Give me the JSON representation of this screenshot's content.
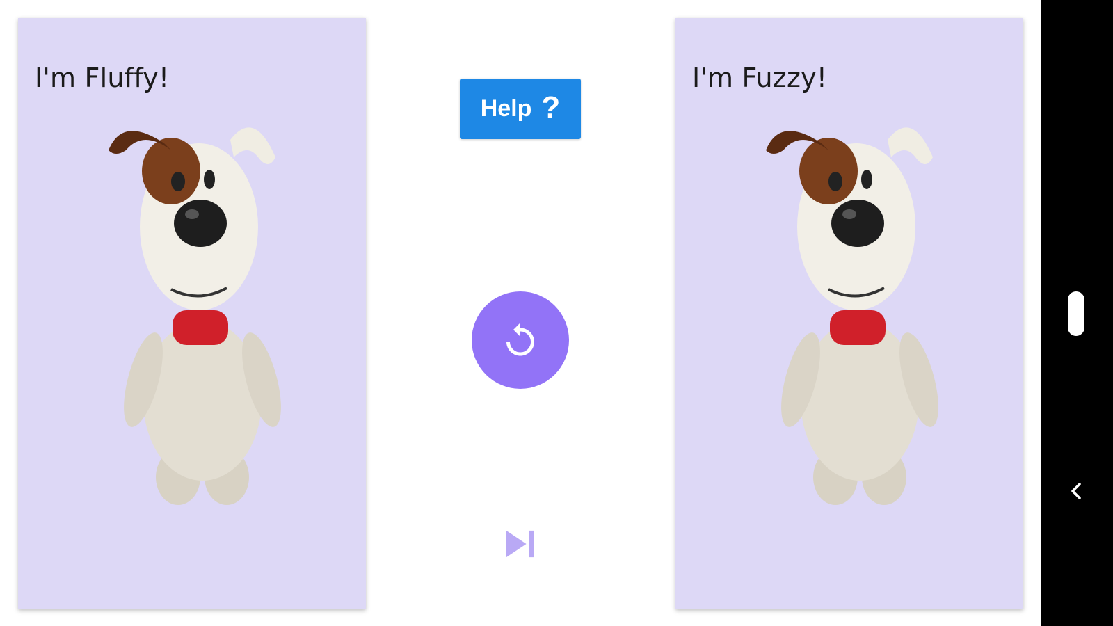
{
  "colors": {
    "card_background": "#ddd8f6",
    "help_button": "#1e88e5",
    "reset_button": "#9273f7",
    "skip_icon": "#b9a9f5",
    "nav_bar": "#000000"
  },
  "cards": {
    "left": {
      "title": "I'm Fluffy!",
      "image": "cartoon-dog"
    },
    "right": {
      "title": "I'm Fuzzy!",
      "image": "cartoon-dog"
    }
  },
  "controls": {
    "help_label": "Help",
    "help_icon": "question-mark-icon",
    "reset_icon": "reset-icon",
    "skip_icon": "skip-next-icon"
  },
  "nav": {
    "home_icon": "home-pill",
    "back_icon": "back-chevron-icon"
  }
}
